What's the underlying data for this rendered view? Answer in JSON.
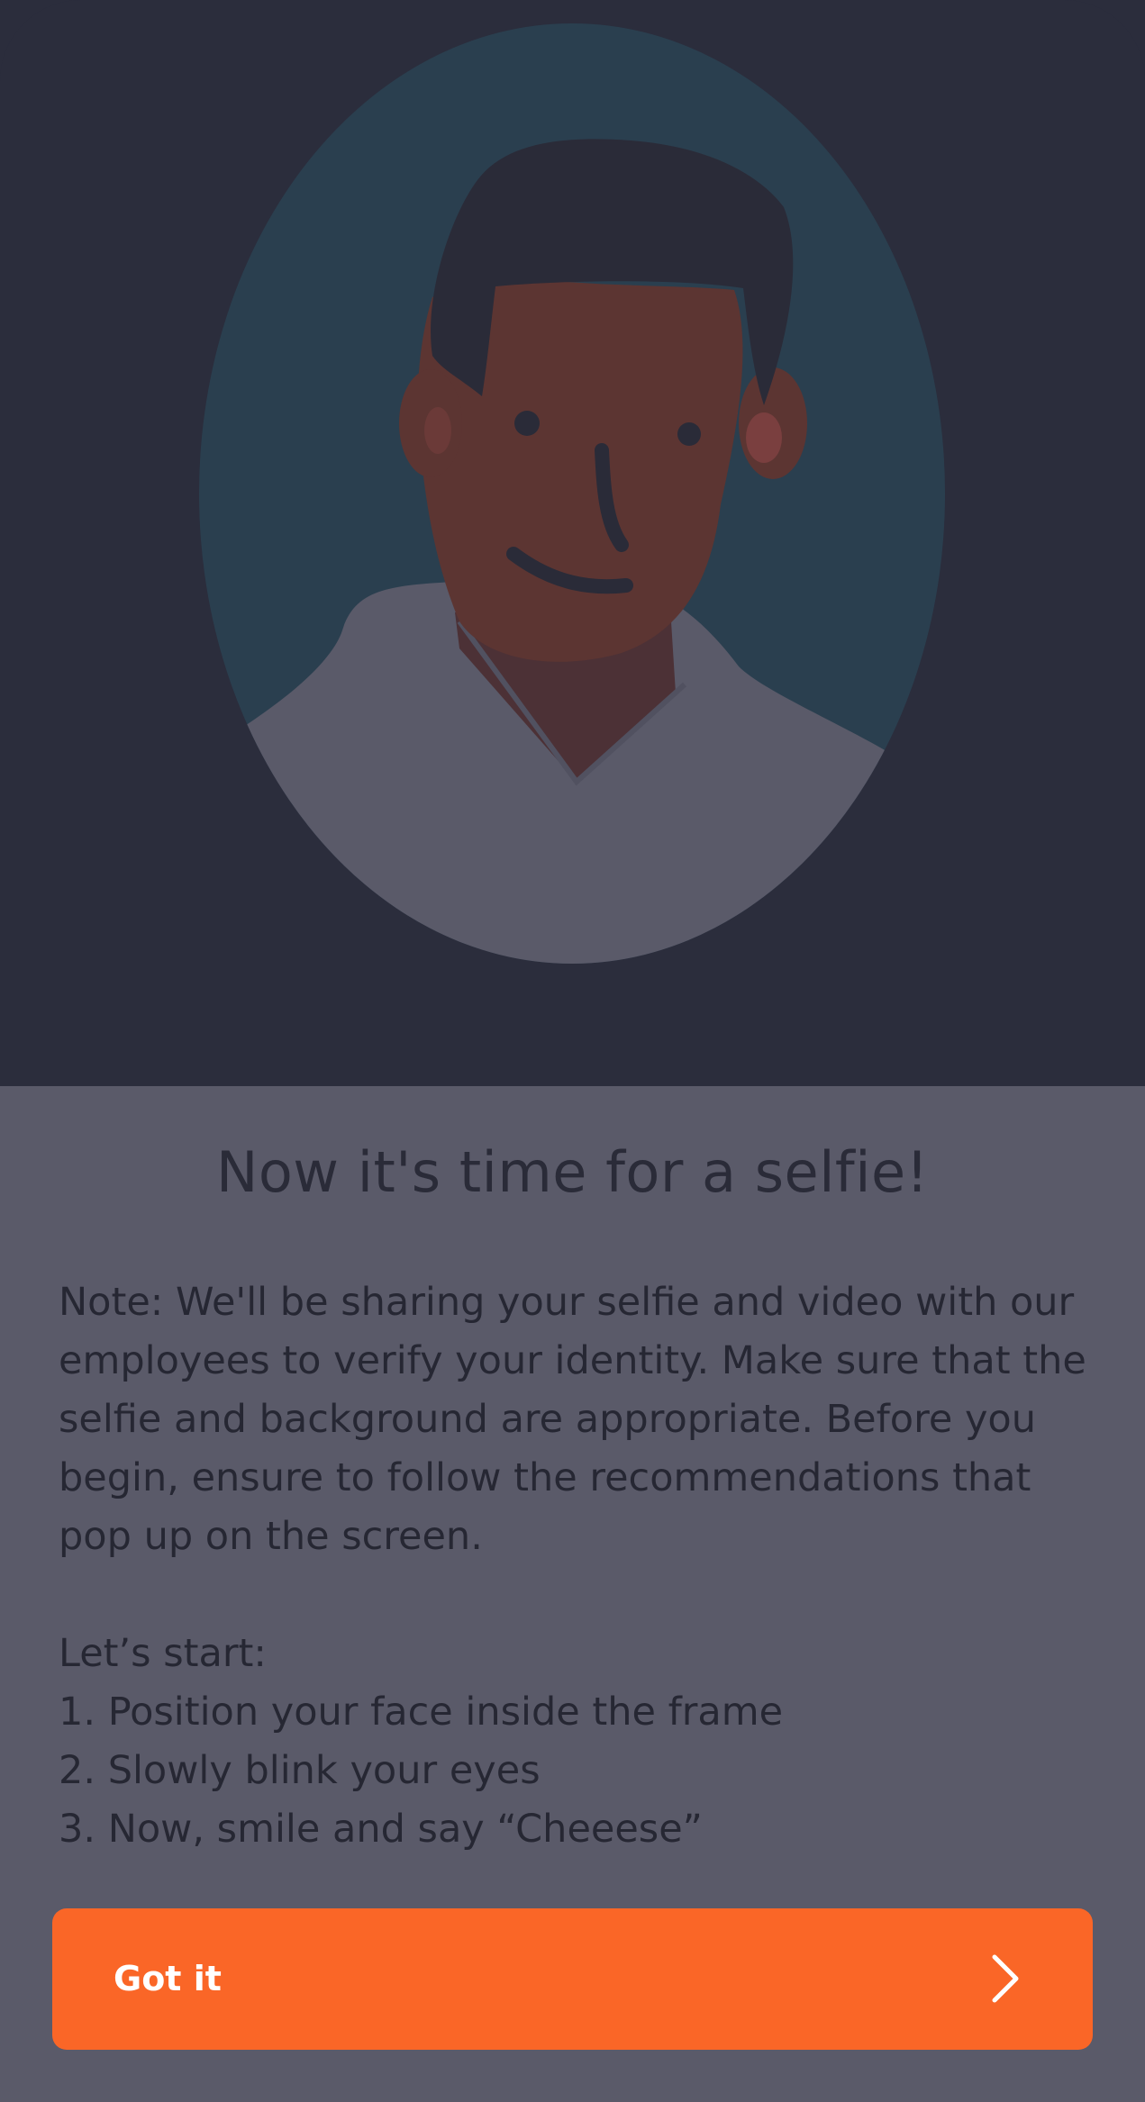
{
  "illustration": {
    "icon": "selfie-person-illustration"
  },
  "screen": {
    "title": "Now it's time for a selfie!",
    "note": "Note: We'll be sharing your selfie and video with our employees to verify your identity. Make sure that the selfie and background are appropriate. Before you begin, ensure to follow the recommendations that pop up on the screen.",
    "steps_heading": "Let’s start:",
    "steps": [
      "1. Position your face inside the frame",
      "2. Slowly blink your eyes",
      "3. Now, smile and say “Cheeese”"
    ]
  },
  "button": {
    "label": "Got it",
    "icon": "chevron-right-icon"
  },
  "colors": {
    "background": "#2b2d3c",
    "sheet": "#5a5a69",
    "accent": "#fa6627"
  }
}
